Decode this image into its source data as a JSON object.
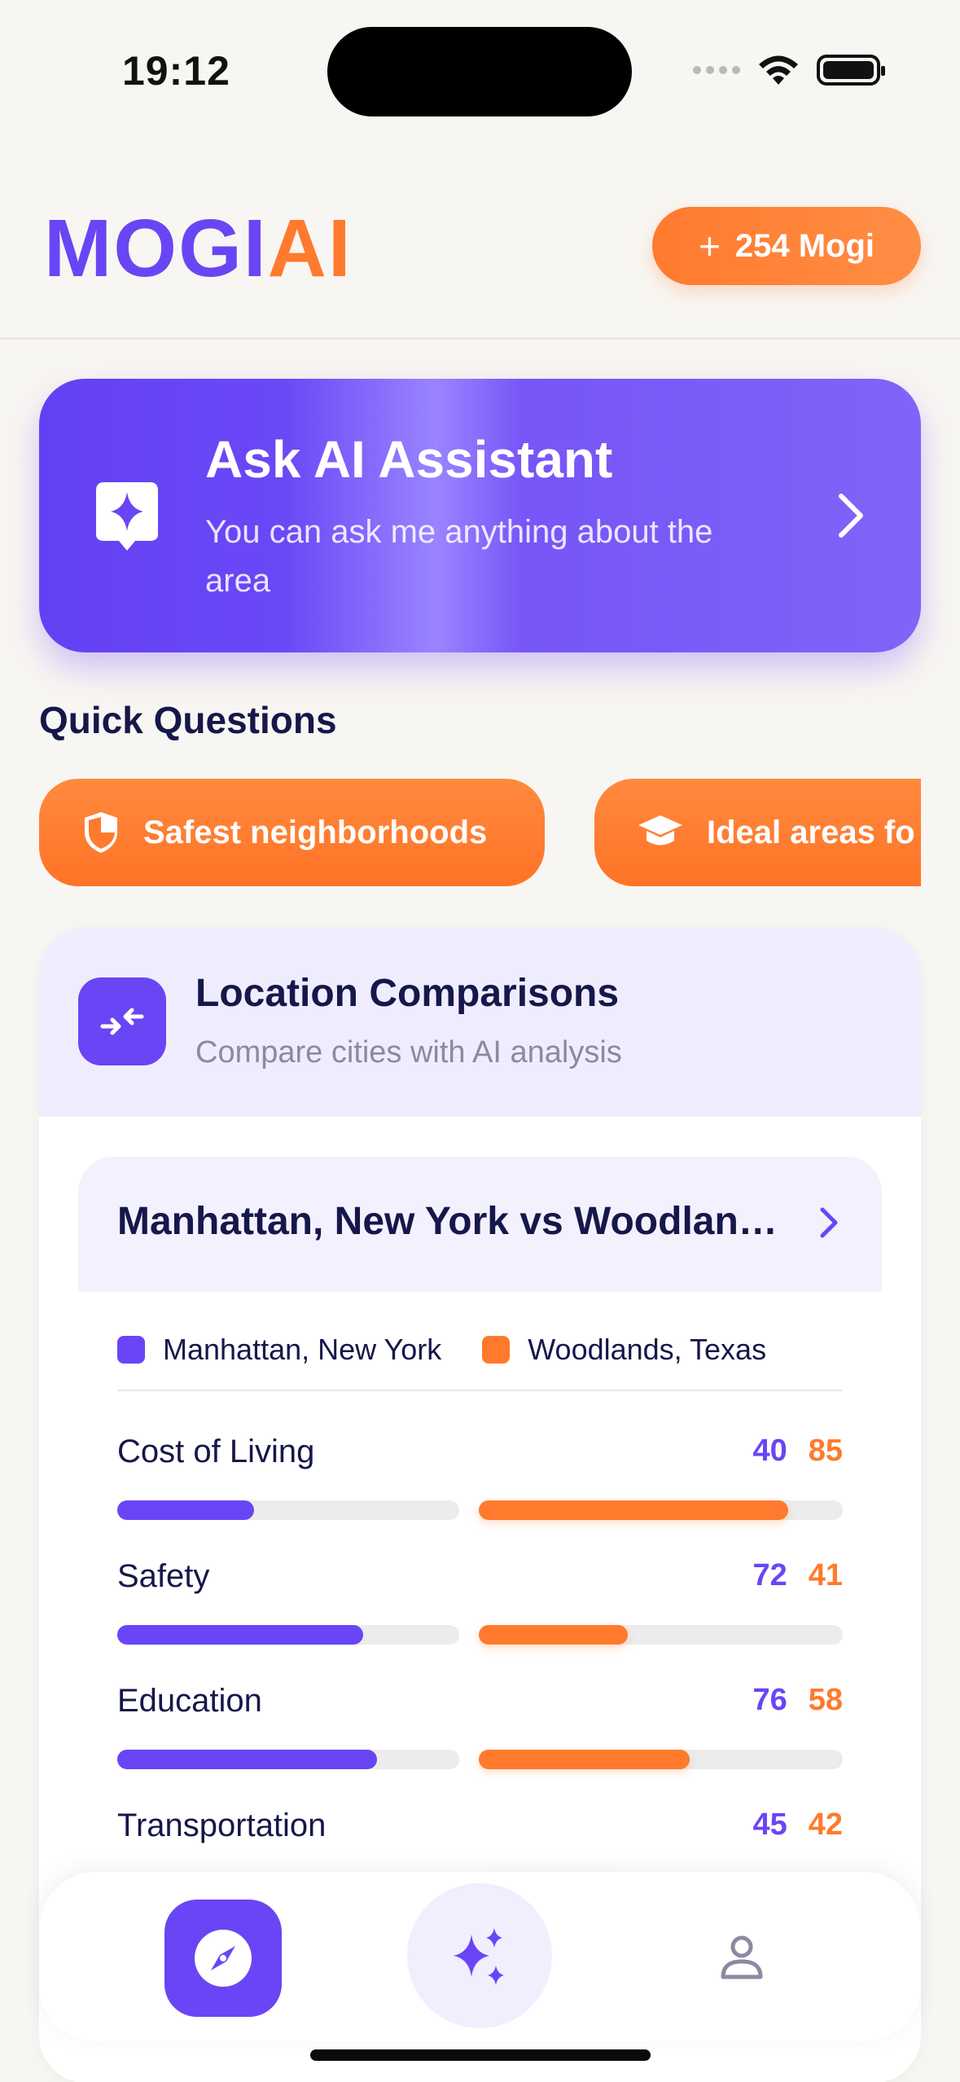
{
  "status_bar": {
    "time": "19:12"
  },
  "header": {
    "logo_part1": "MOGI",
    "logo_part2": "AI",
    "credits_label": "254 Mogi",
    "credits_icon": "plus-icon"
  },
  "ask_card": {
    "title": "Ask AI Assistant",
    "subtitle": "You can ask me anything about the area",
    "icon": "sparkle-chat-icon"
  },
  "quick_questions": {
    "title": "Quick Questions",
    "chips": [
      {
        "label": "Safest neighborhoods",
        "icon": "shield-icon"
      },
      {
        "label": "Ideal areas fo",
        "icon": "graduation-cap-icon"
      }
    ]
  },
  "comparisons": {
    "title": "Location Comparisons",
    "subtitle": "Compare cities with AI analysis",
    "pair_title": "Manhattan, New York vs Woodlands, Texas",
    "legend": [
      {
        "label": "Manhattan, New York",
        "color": "#6a45f5"
      },
      {
        "label": "Woodlands, Texas",
        "color": "#ff7a2c"
      }
    ],
    "metrics": [
      {
        "label": "Cost of Living",
        "a": "40",
        "b": "85",
        "a_fill": 0.4,
        "b_fill": 0.85
      },
      {
        "label": "Safety",
        "a": "72",
        "b": "41",
        "a_fill": 0.72,
        "b_fill": 0.41
      },
      {
        "label": "Education",
        "a": "76",
        "b": "58",
        "a_fill": 0.76,
        "b_fill": 0.58
      },
      {
        "label": "Transportation",
        "a": "45",
        "b": "42",
        "a_fill": 0.45,
        "b_fill": 0.42
      }
    ]
  },
  "tabbar": {
    "tabs": [
      {
        "name": "explore",
        "icon": "compass-icon",
        "active": true
      },
      {
        "name": "ai",
        "icon": "sparkles-icon",
        "active": false
      },
      {
        "name": "profile",
        "icon": "user-icon",
        "active": false
      }
    ]
  },
  "colors": {
    "brand_purple": "#6a45f5",
    "brand_orange": "#ff7a2c",
    "background": "#f8f6f2"
  }
}
